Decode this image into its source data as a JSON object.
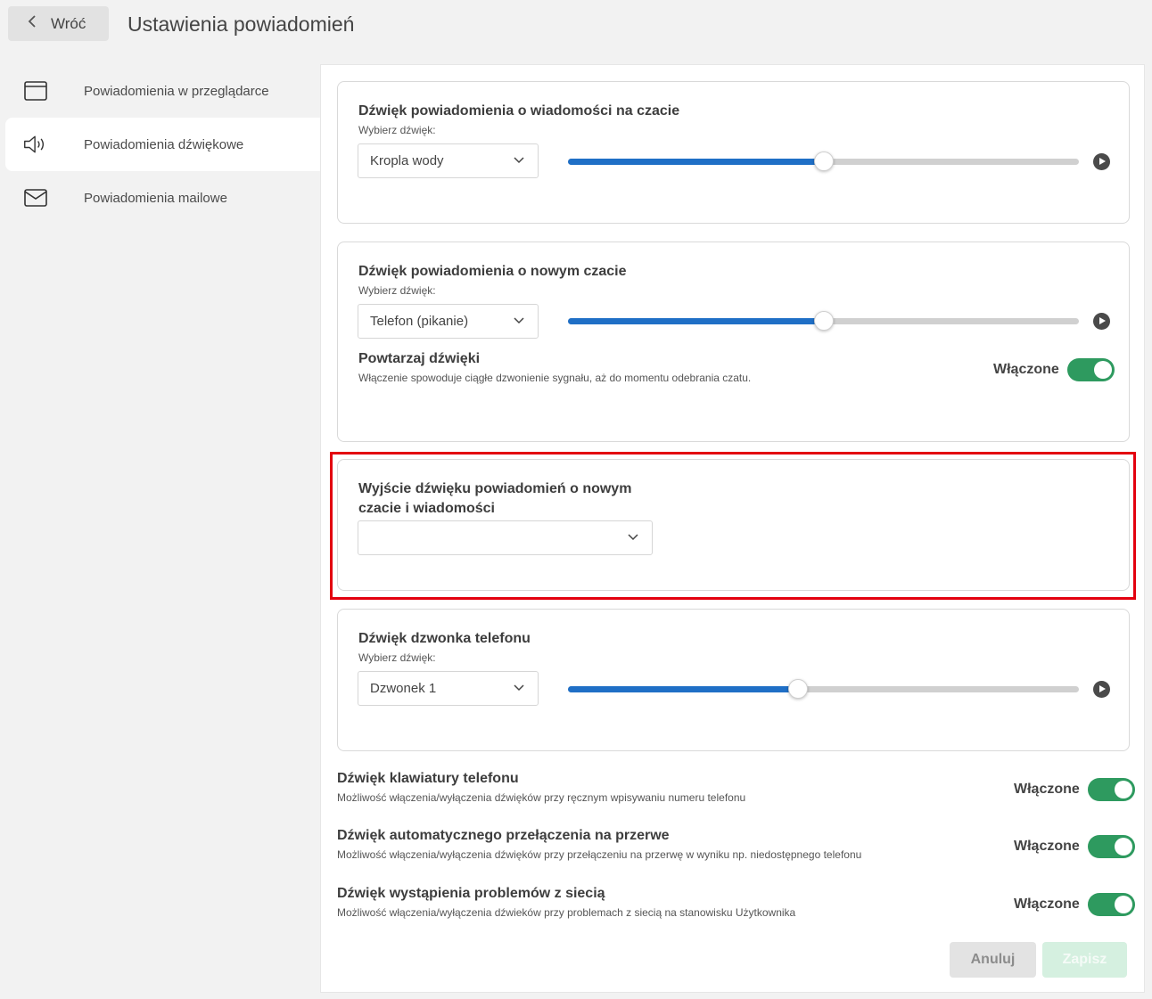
{
  "header": {
    "back_label": "Wróć",
    "title": "Ustawienia powiadomień"
  },
  "sidebar": {
    "items": [
      {
        "label": "Powiadomienia w przeglądarce",
        "icon": "browser-window-icon",
        "active": false
      },
      {
        "label": "Powiadomienia dźwiękowe",
        "icon": "speaker-icon",
        "active": true
      },
      {
        "label": "Powiadomienia mailowe",
        "icon": "envelope-icon",
        "active": false
      }
    ]
  },
  "cards": {
    "message_sound": {
      "title": "Dźwięk powiadomienia o wiadomości na czacie",
      "sub": "Wybierz dźwięk:",
      "selected": "Kropla wody",
      "volume": 0.5
    },
    "new_chat_sound": {
      "title": "Dźwięk powiadomienia o nowym czacie",
      "sub": "Wybierz dźwięk:",
      "selected": "Telefon (pikanie)",
      "volume": 0.5,
      "repeat_title": "Powtarzaj dźwięki",
      "repeat_desc": "Włączenie spowoduje ciągłe dzwonienie sygnału, aż do momentu odebrania czatu.",
      "repeat_state": "Włączone"
    },
    "output": {
      "title_line1": "Wyjście dźwięku powiadomień o nowym",
      "title_line2": "czacie i wiadomości",
      "selected": ""
    },
    "ringtone": {
      "title": "Dźwięk dzwonka telefonu",
      "sub": "Wybierz dźwięk:",
      "selected": "Dzwonek 1",
      "volume": 0.45
    }
  },
  "toggles": [
    {
      "title": "Dźwięk klawiatury telefonu",
      "desc": "Możliwość włączenia/wyłączenia dźwięków przy ręcznym wpisywaniu numeru telefonu",
      "state": "Włączone"
    },
    {
      "title": "Dźwięk automatycznego przełączenia na przerwe",
      "desc": "Możliwość włączenia/wyłączenia dźwięków przy przełączeniu na przerwę w wyniku np. niedostępnego telefonu",
      "state": "Włączone"
    },
    {
      "title": "Dźwięk wystąpienia problemów z siecią",
      "desc": "Możliwość włączenia/wyłączenia dźwieków przy problemach z siecią na stanowisku Użytkownika",
      "state": "Włączone"
    }
  ],
  "footer": {
    "cancel_label": "Anuluj",
    "save_label": "Zapisz"
  },
  "colors": {
    "accent_blue": "#1f6fc6",
    "toggle_green": "#2e9a5f",
    "highlight_red": "#e3000f"
  }
}
